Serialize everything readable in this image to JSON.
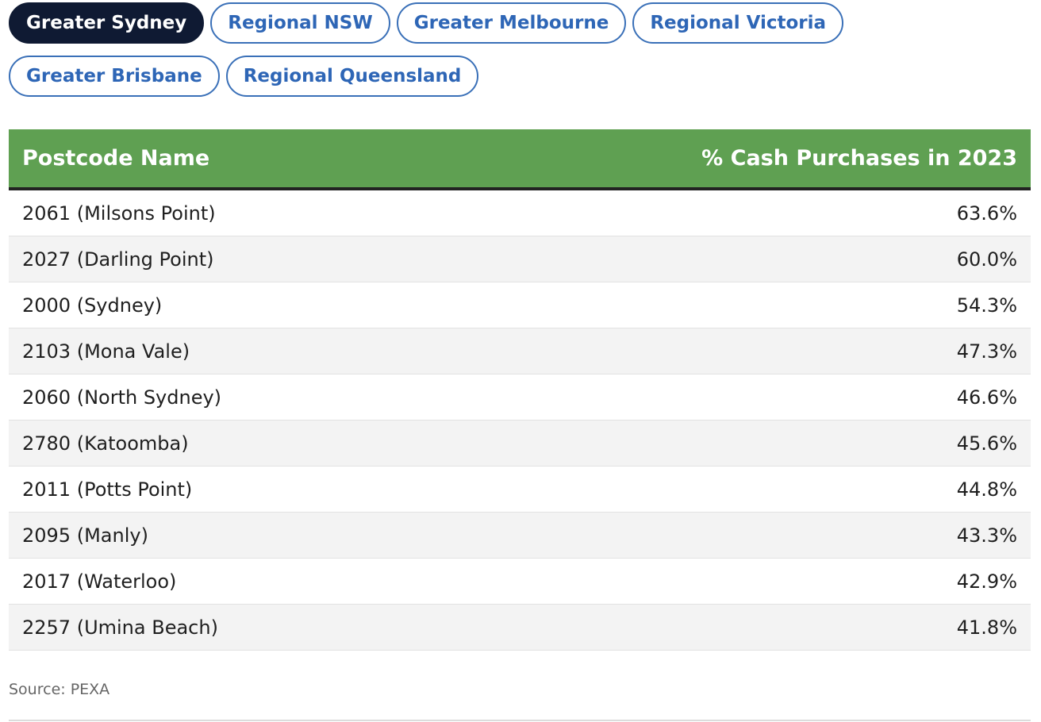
{
  "tabs": [
    {
      "label": "Greater Sydney",
      "active": true
    },
    {
      "label": "Regional NSW",
      "active": false
    },
    {
      "label": "Greater Melbourne",
      "active": false
    },
    {
      "label": "Regional Victoria",
      "active": false
    },
    {
      "label": "Greater Brisbane",
      "active": false
    },
    {
      "label": "Regional Queensland",
      "active": false
    }
  ],
  "table": {
    "columns": [
      "Postcode Name",
      "% Cash Purchases in 2023"
    ],
    "rows": [
      {
        "name": "2061 (Milsons Point)",
        "value": "63.6%"
      },
      {
        "name": "2027 (Darling Point)",
        "value": "60.0%"
      },
      {
        "name": "2000 (Sydney)",
        "value": "54.3%"
      },
      {
        "name": "2103 (Mona Vale)",
        "value": "47.3%"
      },
      {
        "name": "2060 (North Sydney)",
        "value": "46.6%"
      },
      {
        "name": "2780 (Katoomba)",
        "value": "45.6%"
      },
      {
        "name": "2011 (Potts Point)",
        "value": "44.8%"
      },
      {
        "name": "2095 (Manly)",
        "value": "43.3%"
      },
      {
        "name": "2017 (Waterloo)",
        "value": "42.9%"
      },
      {
        "name": "2257 (Umina Beach)",
        "value": "41.8%"
      }
    ]
  },
  "source": "Source: PEXA",
  "colors": {
    "header_green": "#5fa052",
    "active_tab": "#0f1a33",
    "tab_blue": "#2e66b6"
  }
}
